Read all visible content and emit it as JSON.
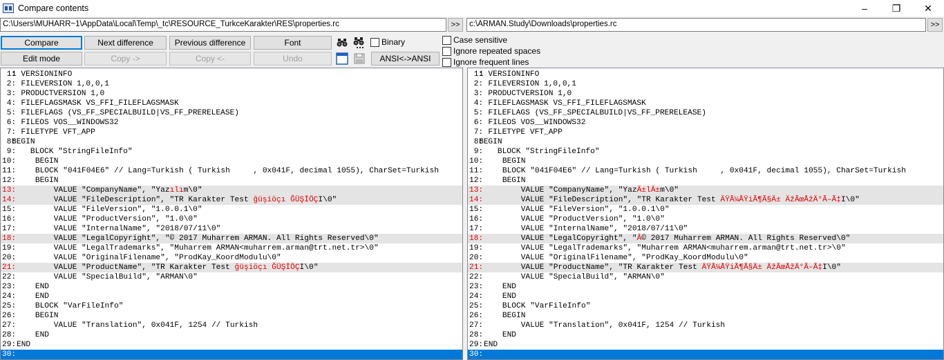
{
  "window": {
    "title": "Compare contents",
    "controls": [
      "–",
      "❐",
      "✕"
    ]
  },
  "paths": {
    "left": "C:\\Users\\MUHARR~1\\AppData\\Local\\Temp\\_tc\\RESOURCE_TurkceKarakter\\RES\\properties.rc",
    "right": "c:\\ARMAN.Study\\Downloads\\properties.rc",
    "browse_label": ">>"
  },
  "toolbar": {
    "compare": "Compare",
    "next_difference": "Next difference",
    "previous_difference": "Previous difference",
    "font": "Font",
    "binary": "Binary",
    "edit_mode": "Edit mode",
    "copy_right": "Copy ->",
    "copy_left": "Copy <-",
    "undo": "Undo",
    "ansi": "ANSI<->ANSI"
  },
  "options": {
    "case_sensitive": "Case sensitive",
    "ignore_repeated_spaces": "Ignore repeated spaces",
    "ignore_frequent_lines": "Ignore frequent lines"
  },
  "colors": {
    "diff_line_number": "#e00000",
    "diff_background": "#e4e4e4",
    "cursor_line": "#0078d7"
  },
  "left_lines": [
    {
      "n": "1:",
      "segs": [
        {
          "t": "1 VERSIONINFO"
        }
      ]
    },
    {
      "n": "2:",
      "segs": [
        {
          "t": "  FILEVERSION 1,0,0,1"
        }
      ]
    },
    {
      "n": "3:",
      "segs": [
        {
          "t": "  PRODUCTVERSION 1,0"
        }
      ]
    },
    {
      "n": "4:",
      "segs": [
        {
          "t": "  FILEFLAGSMASK VS_FFI_FILEFLAGSMASK"
        }
      ]
    },
    {
      "n": "5:",
      "segs": [
        {
          "t": "  FILEFLAGS (VS_FF_SPECIALBUILD|VS_FF_PRERELEASE)"
        }
      ]
    },
    {
      "n": "6:",
      "segs": [
        {
          "t": "  FILEOS VOS__WINDOWS32"
        }
      ]
    },
    {
      "n": "7:",
      "segs": [
        {
          "t": "  FILETYPE VFT_APP"
        }
      ]
    },
    {
      "n": "8:",
      "segs": [
        {
          "t": "BEGIN"
        }
      ]
    },
    {
      "n": "9:",
      "segs": [
        {
          "t": "    BLOCK \"StringFileInfo\""
        }
      ]
    },
    {
      "n": "10:",
      "segs": [
        {
          "t": "    BEGIN"
        }
      ]
    },
    {
      "n": "11:",
      "segs": [
        {
          "t": "    BLOCK \"041F04E6\" // Lang=Turkish ( Turkish     , 0x041F, decimal 1055), CharSet=Turkish"
        }
      ]
    },
    {
      "n": "12:",
      "segs": [
        {
          "t": "    BEGIN"
        }
      ]
    },
    {
      "n": "13:",
      "diff": true,
      "segs": [
        {
          "t": "        VALUE \"CompanyName\", \"Yaz"
        },
        {
          "t": "ılı",
          "red": true
        },
        {
          "t": "m\\0\""
        }
      ]
    },
    {
      "n": "14:",
      "diff": true,
      "segs": [
        {
          "t": "        VALUE \"FileDescription\", \"TR Karakter Test "
        },
        {
          "t": "ğüşiöçı ĞÜŞİÖÇ",
          "red": true
        },
        {
          "t": "I\\0\""
        }
      ]
    },
    {
      "n": "15:",
      "segs": [
        {
          "t": "        VALUE \"FileVersion\", \"1.0.0.1\\0\""
        }
      ]
    },
    {
      "n": "16:",
      "segs": [
        {
          "t": "        VALUE \"ProductVersion\", \"1.0\\0\""
        }
      ]
    },
    {
      "n": "17:",
      "segs": [
        {
          "t": "        VALUE \"InternalName\", \"2018/07/11\\0\""
        }
      ]
    },
    {
      "n": "18:",
      "diff": true,
      "segs": [
        {
          "t": "        VALUE \"LegalCopyright\", \"© 2017 Muharrem ARMAN. All Rights Reserved\\0\""
        }
      ]
    },
    {
      "n": "19:",
      "segs": [
        {
          "t": "        VALUE \"LegalTrademarks\", \"Muharrem ARMAN<muharrem.arman@trt.net.tr>\\0\""
        }
      ]
    },
    {
      "n": "20:",
      "segs": [
        {
          "t": "        VALUE \"OriginalFilename\", \"ProdKay_KoordModulu\\0\""
        }
      ]
    },
    {
      "n": "21:",
      "diff": true,
      "segs": [
        {
          "t": "        VALUE \"ProductName\", \"TR Karakter Test "
        },
        {
          "t": "ğüşiöçı ĞÜŞİÖÇ",
          "red": true
        },
        {
          "t": "I\\0\""
        }
      ]
    },
    {
      "n": "22:",
      "segs": [
        {
          "t": "        VALUE \"SpecialBuild\", \"ARMAN\\0\""
        }
      ]
    },
    {
      "n": "23:",
      "segs": [
        {
          "t": "    END"
        }
      ]
    },
    {
      "n": "24:",
      "segs": [
        {
          "t": "    END"
        }
      ]
    },
    {
      "n": "25:",
      "segs": [
        {
          "t": "    BLOCK \"VarFileInfo\""
        }
      ]
    },
    {
      "n": "26:",
      "segs": [
        {
          "t": "    BEGIN"
        }
      ]
    },
    {
      "n": "27:",
      "segs": [
        {
          "t": "        VALUE \"Translation\", 0x041F, 1254 // Turkish"
        }
      ]
    },
    {
      "n": "28:",
      "segs": [
        {
          "t": "    END"
        }
      ]
    },
    {
      "n": "29:",
      "segs": [
        {
          "t": "END"
        }
      ]
    },
    {
      "n": "30:",
      "cursor": true,
      "segs": [
        {
          "t": ""
        }
      ]
    }
  ],
  "right_lines": [
    {
      "n": "1:",
      "segs": [
        {
          "t": "1 VERSIONINFO"
        }
      ]
    },
    {
      "n": "2:",
      "segs": [
        {
          "t": "  FILEVERSION 1,0,0,1"
        }
      ]
    },
    {
      "n": "3:",
      "segs": [
        {
          "t": "  PRODUCTVERSION 1,0"
        }
      ]
    },
    {
      "n": "4:",
      "segs": [
        {
          "t": "  FILEFLAGSMASK VS_FFI_FILEFLAGSMASK"
        }
      ]
    },
    {
      "n": "5:",
      "segs": [
        {
          "t": "  FILEFLAGS (VS_FF_SPECIALBUILD|VS_FF_PRERELEASE)"
        }
      ]
    },
    {
      "n": "6:",
      "segs": [
        {
          "t": "  FILEOS VOS__WINDOWS32"
        }
      ]
    },
    {
      "n": "7:",
      "segs": [
        {
          "t": "  FILETYPE VFT_APP"
        }
      ]
    },
    {
      "n": "8:",
      "segs": [
        {
          "t": "BEGIN"
        }
      ]
    },
    {
      "n": "9:",
      "segs": [
        {
          "t": "    BLOCK \"StringFileInfo\""
        }
      ]
    },
    {
      "n": "10:",
      "segs": [
        {
          "t": "    BEGIN"
        }
      ]
    },
    {
      "n": "11:",
      "segs": [
        {
          "t": "    BLOCK \"041F04E6\" // Lang=Turkish ( Turkish     , 0x041F, decimal 1055), CharSet=Turkish"
        }
      ]
    },
    {
      "n": "12:",
      "segs": [
        {
          "t": "    BEGIN"
        }
      ]
    },
    {
      "n": "13:",
      "diff": true,
      "segs": [
        {
          "t": "        VALUE \"CompanyName\", \"Yaz"
        },
        {
          "t": "Ä±lÄ±",
          "red": true
        },
        {
          "t": "m\\0\""
        }
      ]
    },
    {
      "n": "14:",
      "diff": true,
      "segs": [
        {
          "t": "        VALUE \"FileDescription\", \"TR Karakter Test "
        },
        {
          "t": "ÄŸÃ¼ÅŸiÃ¶Ã§Ä± ÄžÃœÅžÄ°Ã–Ã‡",
          "red": true
        },
        {
          "t": "I\\0\""
        }
      ]
    },
    {
      "n": "15:",
      "segs": [
        {
          "t": "        VALUE \"FileVersion\", \"1.0.0.1\\0\""
        }
      ]
    },
    {
      "n": "16:",
      "segs": [
        {
          "t": "        VALUE \"ProductVersion\", \"1.0\\0\""
        }
      ]
    },
    {
      "n": "17:",
      "segs": [
        {
          "t": "        VALUE \"InternalName\", \"2018/07/11\\0\""
        }
      ]
    },
    {
      "n": "18:",
      "diff": true,
      "segs": [
        {
          "t": "        VALUE \"LegalCopyright\", \""
        },
        {
          "t": "Â",
          "red": true
        },
        {
          "t": "© 2017 Muharrem ARMAN. All Rights Reserved\\0\""
        }
      ]
    },
    {
      "n": "19:",
      "segs": [
        {
          "t": "        VALUE \"LegalTrademarks\", \"Muharrem ARMAN<muharrem.arman@trt.net.tr>\\0\""
        }
      ]
    },
    {
      "n": "20:",
      "segs": [
        {
          "t": "        VALUE \"OriginalFilename\", \"ProdKay_KoordModulu\\0\""
        }
      ]
    },
    {
      "n": "21:",
      "diff": true,
      "segs": [
        {
          "t": "        VALUE \"ProductName\", \"TR Karakter Test "
        },
        {
          "t": "ÄŸÃ¼ÅŸiÃ¶Ã§Ä± ÄžÃœÅžÄ°Ã–Ã‡",
          "red": true
        },
        {
          "t": "I\\0\""
        }
      ]
    },
    {
      "n": "22:",
      "segs": [
        {
          "t": "        VALUE \"SpecialBuild\", \"ARMAN\\0\""
        }
      ]
    },
    {
      "n": "23:",
      "segs": [
        {
          "t": "    END"
        }
      ]
    },
    {
      "n": "24:",
      "segs": [
        {
          "t": "    END"
        }
      ]
    },
    {
      "n": "25:",
      "segs": [
        {
          "t": "    BLOCK \"VarFileInfo\""
        }
      ]
    },
    {
      "n": "26:",
      "segs": [
        {
          "t": "    BEGIN"
        }
      ]
    },
    {
      "n": "27:",
      "segs": [
        {
          "t": "        VALUE \"Translation\", 0x041F, 1254 // Turkish"
        }
      ]
    },
    {
      "n": "28:",
      "segs": [
        {
          "t": "    END"
        }
      ]
    },
    {
      "n": "29:",
      "segs": [
        {
          "t": "END"
        }
      ]
    },
    {
      "n": "30:",
      "cursor": true,
      "segs": [
        {
          "t": ""
        }
      ]
    }
  ]
}
